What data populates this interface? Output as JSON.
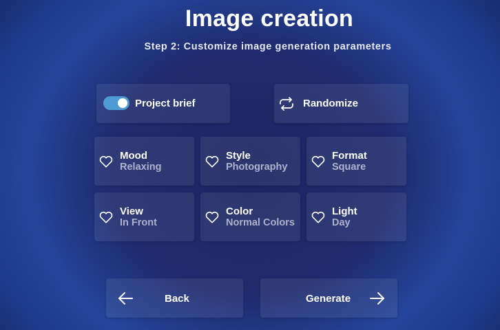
{
  "header": {
    "title": "Image creation",
    "subtitle": "Step 2: Customize image generation parameters"
  },
  "top_row": {
    "project_brief": {
      "label": "Project brief",
      "toggle_on": true,
      "toggle_color": "#4f9bd3"
    },
    "randomize": {
      "label": "Randomize",
      "icon": "repeat-arrows-icon"
    }
  },
  "parameters": [
    {
      "name": "Mood",
      "value": "Relaxing",
      "icon": "heart-outline-icon"
    },
    {
      "name": "Style",
      "value": "Photography",
      "icon": "heart-outline-icon"
    },
    {
      "name": "Format",
      "value": "Square",
      "icon": "heart-outline-icon"
    },
    {
      "name": "View",
      "value": "In Front",
      "icon": "heart-outline-icon"
    },
    {
      "name": "Color",
      "value": "Normal Colors",
      "icon": "heart-outline-icon"
    },
    {
      "name": "Light",
      "value": "Day",
      "icon": "heart-outline-icon"
    }
  ],
  "footer": {
    "back_label": "Back",
    "back_icon": "arrow-left-icon",
    "generate_label": "Generate",
    "generate_icon": "arrow-right-icon"
  },
  "colors": {
    "background_center": "#1c2561",
    "background_edge": "#24449b",
    "secondary_text": "#aeb3cc"
  }
}
